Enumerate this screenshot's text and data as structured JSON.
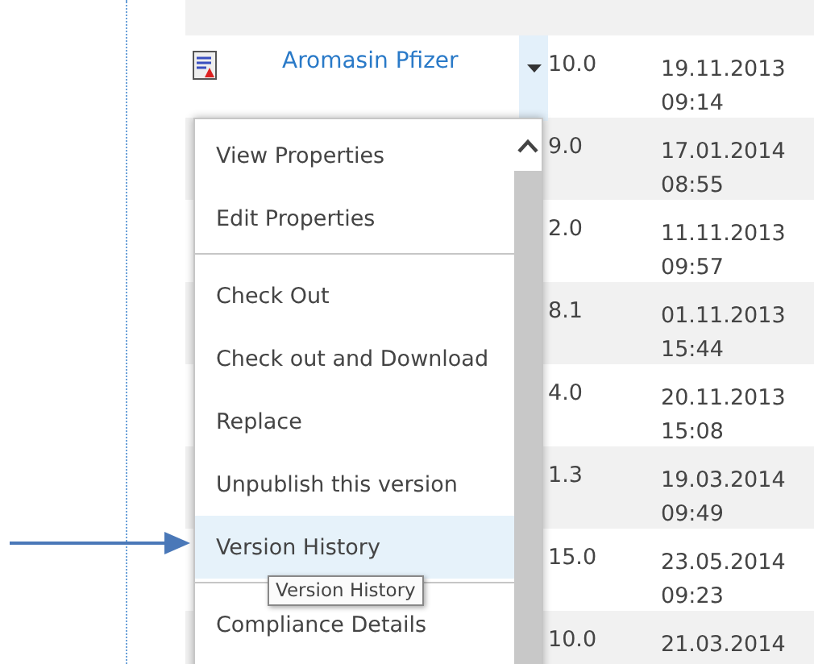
{
  "document_rows": [
    {
      "name": "",
      "version": "",
      "modified": ""
    },
    {
      "name": "Aromasin Pfizer",
      "version": "10.0",
      "modified": "19.11.2013 09:14",
      "menu_open": true
    },
    {
      "name": "",
      "version": "9.0",
      "modified": "17.01.2014 08:55"
    },
    {
      "name": "",
      "version": "2.0",
      "modified": "11.11.2013 09:57"
    },
    {
      "name": "",
      "version": "8.1",
      "modified": "01.11.2013 15:44"
    },
    {
      "name": "",
      "version": "4.0",
      "modified": "20.11.2013 15:08"
    },
    {
      "name": "",
      "version": "1.3",
      "modified": "19.03.2014 09:49"
    },
    {
      "name": "",
      "version": "15.0",
      "modified": "23.05.2014 09:23"
    },
    {
      "name": "",
      "version": "10.0",
      "modified": "21.03.2014"
    }
  ],
  "context_menu": {
    "items": [
      {
        "label": "View Properties",
        "selected": false,
        "divider_after": false
      },
      {
        "label": "Edit Properties",
        "selected": false,
        "divider_after": true
      },
      {
        "label": "Check Out",
        "selected": false,
        "divider_after": false
      },
      {
        "label": "Check out and Download",
        "selected": false,
        "divider_after": false
      },
      {
        "label": "Replace",
        "selected": false,
        "divider_after": false
      },
      {
        "label": "Unpublish this version",
        "selected": false,
        "divider_after": false
      },
      {
        "label": "Version History",
        "selected": true,
        "divider_after": true
      },
      {
        "label": "Compliance Details",
        "selected": false,
        "divider_after": false
      }
    ]
  },
  "tooltip": "Version History"
}
